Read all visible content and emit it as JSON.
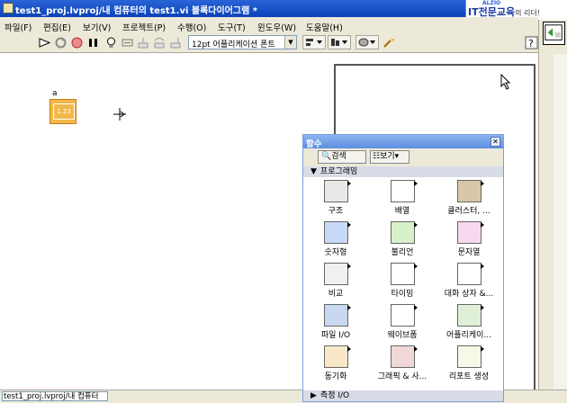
{
  "window": {
    "title": "test1_proj.lvproj/내 컴퓨터의 test1.vi 블록다이어그램 *",
    "brand_top": "ALZIO",
    "brand_main": "IT전문교육",
    "brand_tail": "의 리더!"
  },
  "menu": [
    {
      "label": "파일(F)"
    },
    {
      "label": "편집(E)"
    },
    {
      "label": "보기(V)"
    },
    {
      "label": "프로젝트(P)"
    },
    {
      "label": "수행(O)"
    },
    {
      "label": "도구(T)"
    },
    {
      "label": "윈도우(W)"
    },
    {
      "label": "도움말(H)"
    }
  ],
  "toolbar": {
    "font_select": "12pt 어플리케이션 폰트"
  },
  "diagram": {
    "node_label": "a",
    "node_text": "1.23"
  },
  "status": {
    "path": "test1_proj.lvproj/내 컴퓨터"
  },
  "palette": {
    "title": "함수",
    "search_label": "검색",
    "view_label": "보기",
    "category": "프로그래밍",
    "bottom_category": "측정 I/O",
    "items": [
      {
        "label": "구조",
        "icon": "structure-icon"
      },
      {
        "label": "배열",
        "icon": "array-icon"
      },
      {
        "label": "클러스터, ...",
        "icon": "cluster-icon"
      },
      {
        "label": "숫자형",
        "icon": "numeric-icon"
      },
      {
        "label": "불리언",
        "icon": "boolean-icon"
      },
      {
        "label": "문자열",
        "icon": "string-icon"
      },
      {
        "label": "비교",
        "icon": "comparison-icon"
      },
      {
        "label": "타이밍",
        "icon": "timing-icon"
      },
      {
        "label": "대화 상자 &...",
        "icon": "dialog-icon"
      },
      {
        "label": "파일 I/O",
        "icon": "file-io-icon"
      },
      {
        "label": "웨이브폼",
        "icon": "waveform-icon"
      },
      {
        "label": "어플리케이...",
        "icon": "application-icon"
      },
      {
        "label": "동기화",
        "icon": "synchronization-icon"
      },
      {
        "label": "그래픽 & 사...",
        "icon": "graphics-sound-icon"
      },
      {
        "label": "리포트 생성",
        "icon": "report-icon"
      }
    ]
  }
}
